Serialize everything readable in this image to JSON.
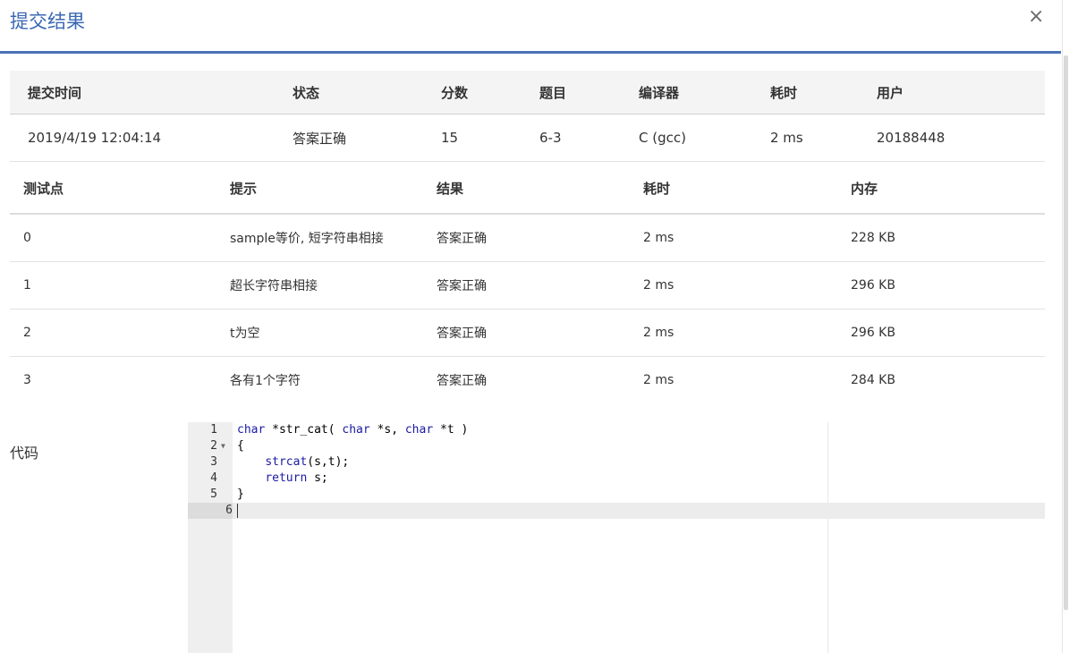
{
  "modal": {
    "title": "提交结果",
    "close_label": "×"
  },
  "summary": {
    "headers": [
      "提交时间",
      "状态",
      "分数",
      "题目",
      "编译器",
      "耗时",
      "用户"
    ],
    "row": {
      "time": "2019/4/19 12:04:14",
      "status": "答案正确",
      "score": "15",
      "problem": "6-3",
      "compiler": "C (gcc)",
      "duration": "2 ms",
      "user": "20188448"
    }
  },
  "cases": {
    "headers": [
      "测试点",
      "提示",
      "结果",
      "耗时",
      "内存"
    ],
    "rows": [
      {
        "id": "0",
        "hint": "sample等价, 短字符串相接",
        "result": "答案正确",
        "time": "2 ms",
        "memory": "228 KB"
      },
      {
        "id": "1",
        "hint": "超长字符串相接",
        "result": "答案正确",
        "time": "2 ms",
        "memory": "296 KB"
      },
      {
        "id": "2",
        "hint": "t为空",
        "result": "答案正确",
        "time": "2 ms",
        "memory": "296 KB"
      },
      {
        "id": "3",
        "hint": "各有1个字符",
        "result": "答案正确",
        "time": "2 ms",
        "memory": "284 KB"
      }
    ]
  },
  "code": {
    "label": "代码",
    "lines": [
      {
        "num": "1",
        "text": "char *str_cat( char *s, char *t )"
      },
      {
        "num": "2",
        "text": "{"
      },
      {
        "num": "3",
        "text": "    strcat(s,t);"
      },
      {
        "num": "4",
        "text": "    return s;"
      },
      {
        "num": "5",
        "text": "}"
      },
      {
        "num": "6",
        "text": ""
      }
    ]
  },
  "colors": {
    "accent": "#3a68b4",
    "success": "#d9412f"
  }
}
